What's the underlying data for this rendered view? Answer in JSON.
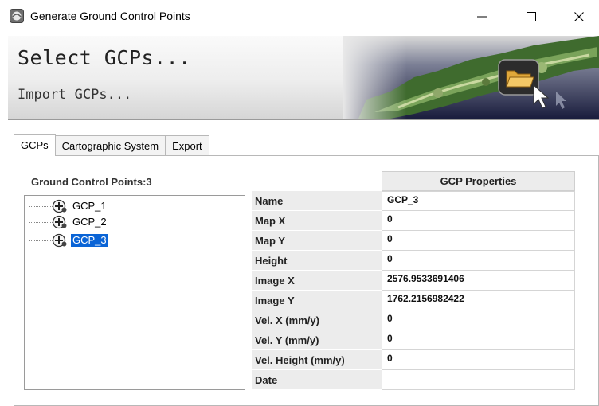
{
  "window": {
    "title": "Generate Ground Control Points",
    "minimize_glyph": "—",
    "maximize_glyph": "☐",
    "close_glyph": "✕"
  },
  "banner": {
    "title": "Select GCPs...",
    "subtitle": "Import GCPs..."
  },
  "tabs": [
    {
      "label": "GCPs",
      "active": true
    },
    {
      "label": "Cartographic System",
      "active": false
    },
    {
      "label": "Export",
      "active": false
    }
  ],
  "gcp_list": {
    "label": "Ground Control Points:3",
    "items": [
      {
        "label": "GCP_1",
        "selected": false
      },
      {
        "label": "GCP_2",
        "selected": false
      },
      {
        "label": "GCP_3",
        "selected": true
      }
    ]
  },
  "properties": {
    "header": "GCP Properties",
    "rows": [
      {
        "name": "Name",
        "value": "GCP_3"
      },
      {
        "name": "Map X",
        "value": "0"
      },
      {
        "name": "Map Y",
        "value": "0"
      },
      {
        "name": "Height",
        "value": "0"
      },
      {
        "name": "Image X",
        "value": "2576.9533691406"
      },
      {
        "name": "Image Y",
        "value": "1762.2156982422"
      },
      {
        "name": "Vel. X (mm/y)",
        "value": "0"
      },
      {
        "name": "Vel. Y (mm/y)",
        "value": "0"
      },
      {
        "name": "Vel. Height (mm/y)",
        "value": "0"
      },
      {
        "name": "Date",
        "value": ""
      }
    ]
  },
  "colors": {
    "selection": "#0a64d6",
    "header_bg": "#ececec"
  }
}
